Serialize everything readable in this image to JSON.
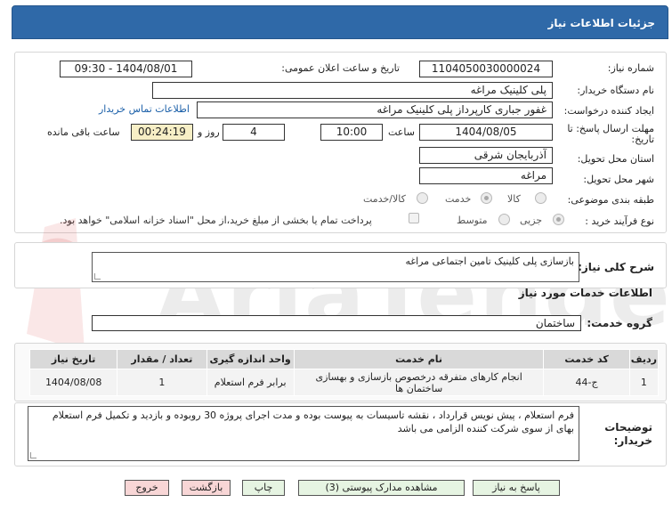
{
  "header": {
    "title": "جزئیات اطلاعات نیاز"
  },
  "info": {
    "need_number_label": "شماره نیاز:",
    "need_number": "1104050030000024",
    "announce_label": "تاریخ و ساعت اعلان عمومی:",
    "announce_value": "1404/08/01 - 09:30",
    "buyer_label": "نام دستگاه خریدار:",
    "buyer_value": "پلی کلینیک مراغه",
    "creator_label": "ایجاد کننده درخواست:",
    "creator_value": "غفور جباری کارپرداز پلی کلینیک مراغه",
    "contact_link": "اطلاعات تماس خریدار",
    "deadline_label_1": "مهلت ارسال پاسخ: تا",
    "deadline_label_2": "تاریخ:",
    "deadline_date": "1404/08/05",
    "time_label": "ساعت",
    "deadline_time": "10:00",
    "days_value": "4",
    "days_label": "روز و",
    "remaining_value": "00:24:19",
    "remaining_label": "ساعت باقی مانده",
    "province_label": "استان محل تحویل:",
    "province_value": "آذربایجان شرقی",
    "city_label": "شهر محل تحویل:",
    "city_value": "مراغه",
    "category_label": "طبقه بندی موضوعی:",
    "category_options": [
      "کالا",
      "خدمت",
      "کالا/خدمت"
    ],
    "category_selected": "خدمت",
    "process_label": "نوع فرآیند خرید :",
    "process_options": [
      "جزیی",
      "متوسط"
    ],
    "payment_note": "پرداخت تمام یا بخشی از مبلغ خرید،از محل \"اسناد خزانه اسلامی\" خواهد بود."
  },
  "description": {
    "label": "شرح کلی نیاز:",
    "value": "بازسازی پلی کلینیک تامین اجتماعی مراغه"
  },
  "services": {
    "section_title": "اطلاعات خدمات مورد نیاز",
    "group_label": "گروه خدمت:",
    "group_value": "ساختمان",
    "columns": [
      "ردیف",
      "کد خدمت",
      "نام خدمت",
      "واحد اندازه گیری",
      "تعداد / مقدار",
      "تاریخ نیاز"
    ],
    "rows": [
      {
        "row": "1",
        "code": "ج-44",
        "name": "انجام کارهای متفرقه درخصوص بازسازی و بهسازی ساختمان ها",
        "unit": "برابر فرم استعلام",
        "qty": "1",
        "date": "1404/08/08"
      }
    ]
  },
  "buyer_notes": {
    "label_1": "توضیحات",
    "label_2": "خریدار:",
    "value": "فرم استعلام ، پیش نویس قرارداد ، نقشه تاسیسات به پیوست بوده و مدت اجرای پروژه 30 روبوده و بازدید و تکمیل فرم استعلام بهای از سوی شرکت کننده الزامی می باشد"
  },
  "buttons": {
    "reply": "پاسخ به نیاز",
    "attachments": "مشاهده مدارک پیوستی (3)",
    "print": "چاپ",
    "back": "بازگشت",
    "exit": "خروج"
  },
  "watermark": {
    "text": "AriaTender.net"
  }
}
